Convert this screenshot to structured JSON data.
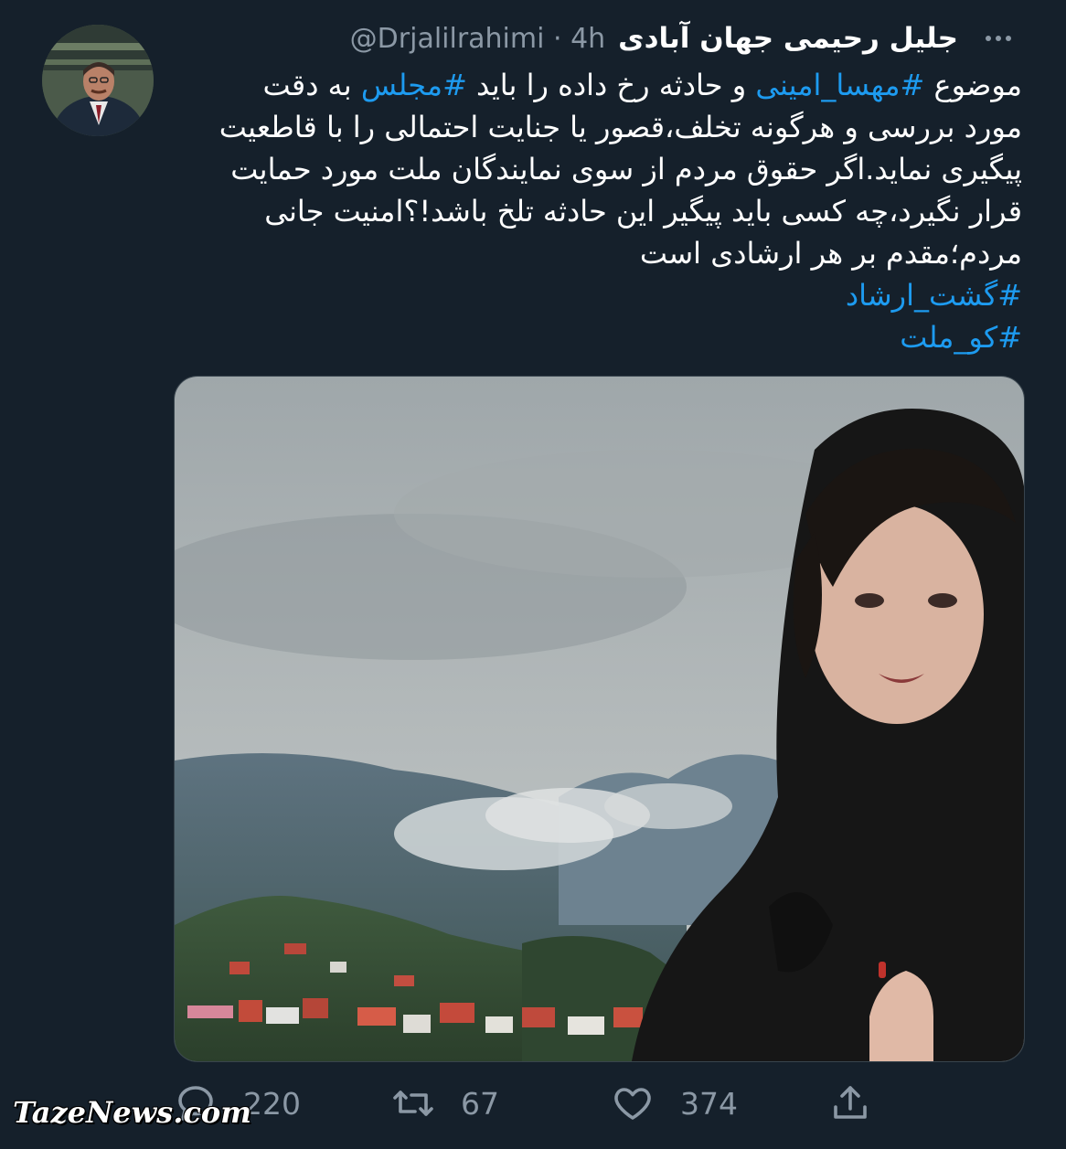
{
  "tweet": {
    "display_name": "جلیل رحیمی جهان آبادی",
    "handle_time": "@Drjalilrahimi · 4h",
    "lines": [
      [
        {
          "t": "موضوع ",
          "h": false
        },
        {
          "t": "#مهسا_امینی",
          "h": true
        },
        {
          "t": " و حادثه رخ داده را باید ",
          "h": false
        },
        {
          "t": "#مجلس",
          "h": true
        },
        {
          "t": " به دقت",
          "h": false
        }
      ],
      [
        {
          "t": "مورد بررسی و هرگونه تخلف،قصور یا جنایت احتمالی را با قاطعیت",
          "h": false
        }
      ],
      [
        {
          "t": "پیگیری نماید.اگر حقوق مردم از سوی نمایندگان ملت مورد حمایت",
          "h": false
        }
      ],
      [
        {
          "t": "قرار نگیرد،چه کسی باید پیگیر این حادثه تلخ باشد!؟امنیت جانی",
          "h": false
        }
      ],
      [
        {
          "t": "مردم؛مقدم بر هر ارشادی است",
          "h": false
        }
      ],
      [
        {
          "t": "#گشت_ارشاد",
          "h": true
        }
      ],
      [
        {
          "t": "#کو_ملت",
          "h": true
        }
      ]
    ]
  },
  "actions": {
    "reply_count": "220",
    "retweet_count": "67",
    "like_count": "374"
  },
  "icons": {
    "more": "more-horizontal-icon",
    "reply": "reply-icon",
    "retweet": "retweet-icon",
    "like": "heart-icon",
    "share": "share-icon"
  },
  "colors": {
    "background": "#15202b",
    "text": "#ffffff",
    "secondary": "#8b98a5",
    "hashtag": "#1d9bf0"
  },
  "watermark": "TazeNews.com"
}
